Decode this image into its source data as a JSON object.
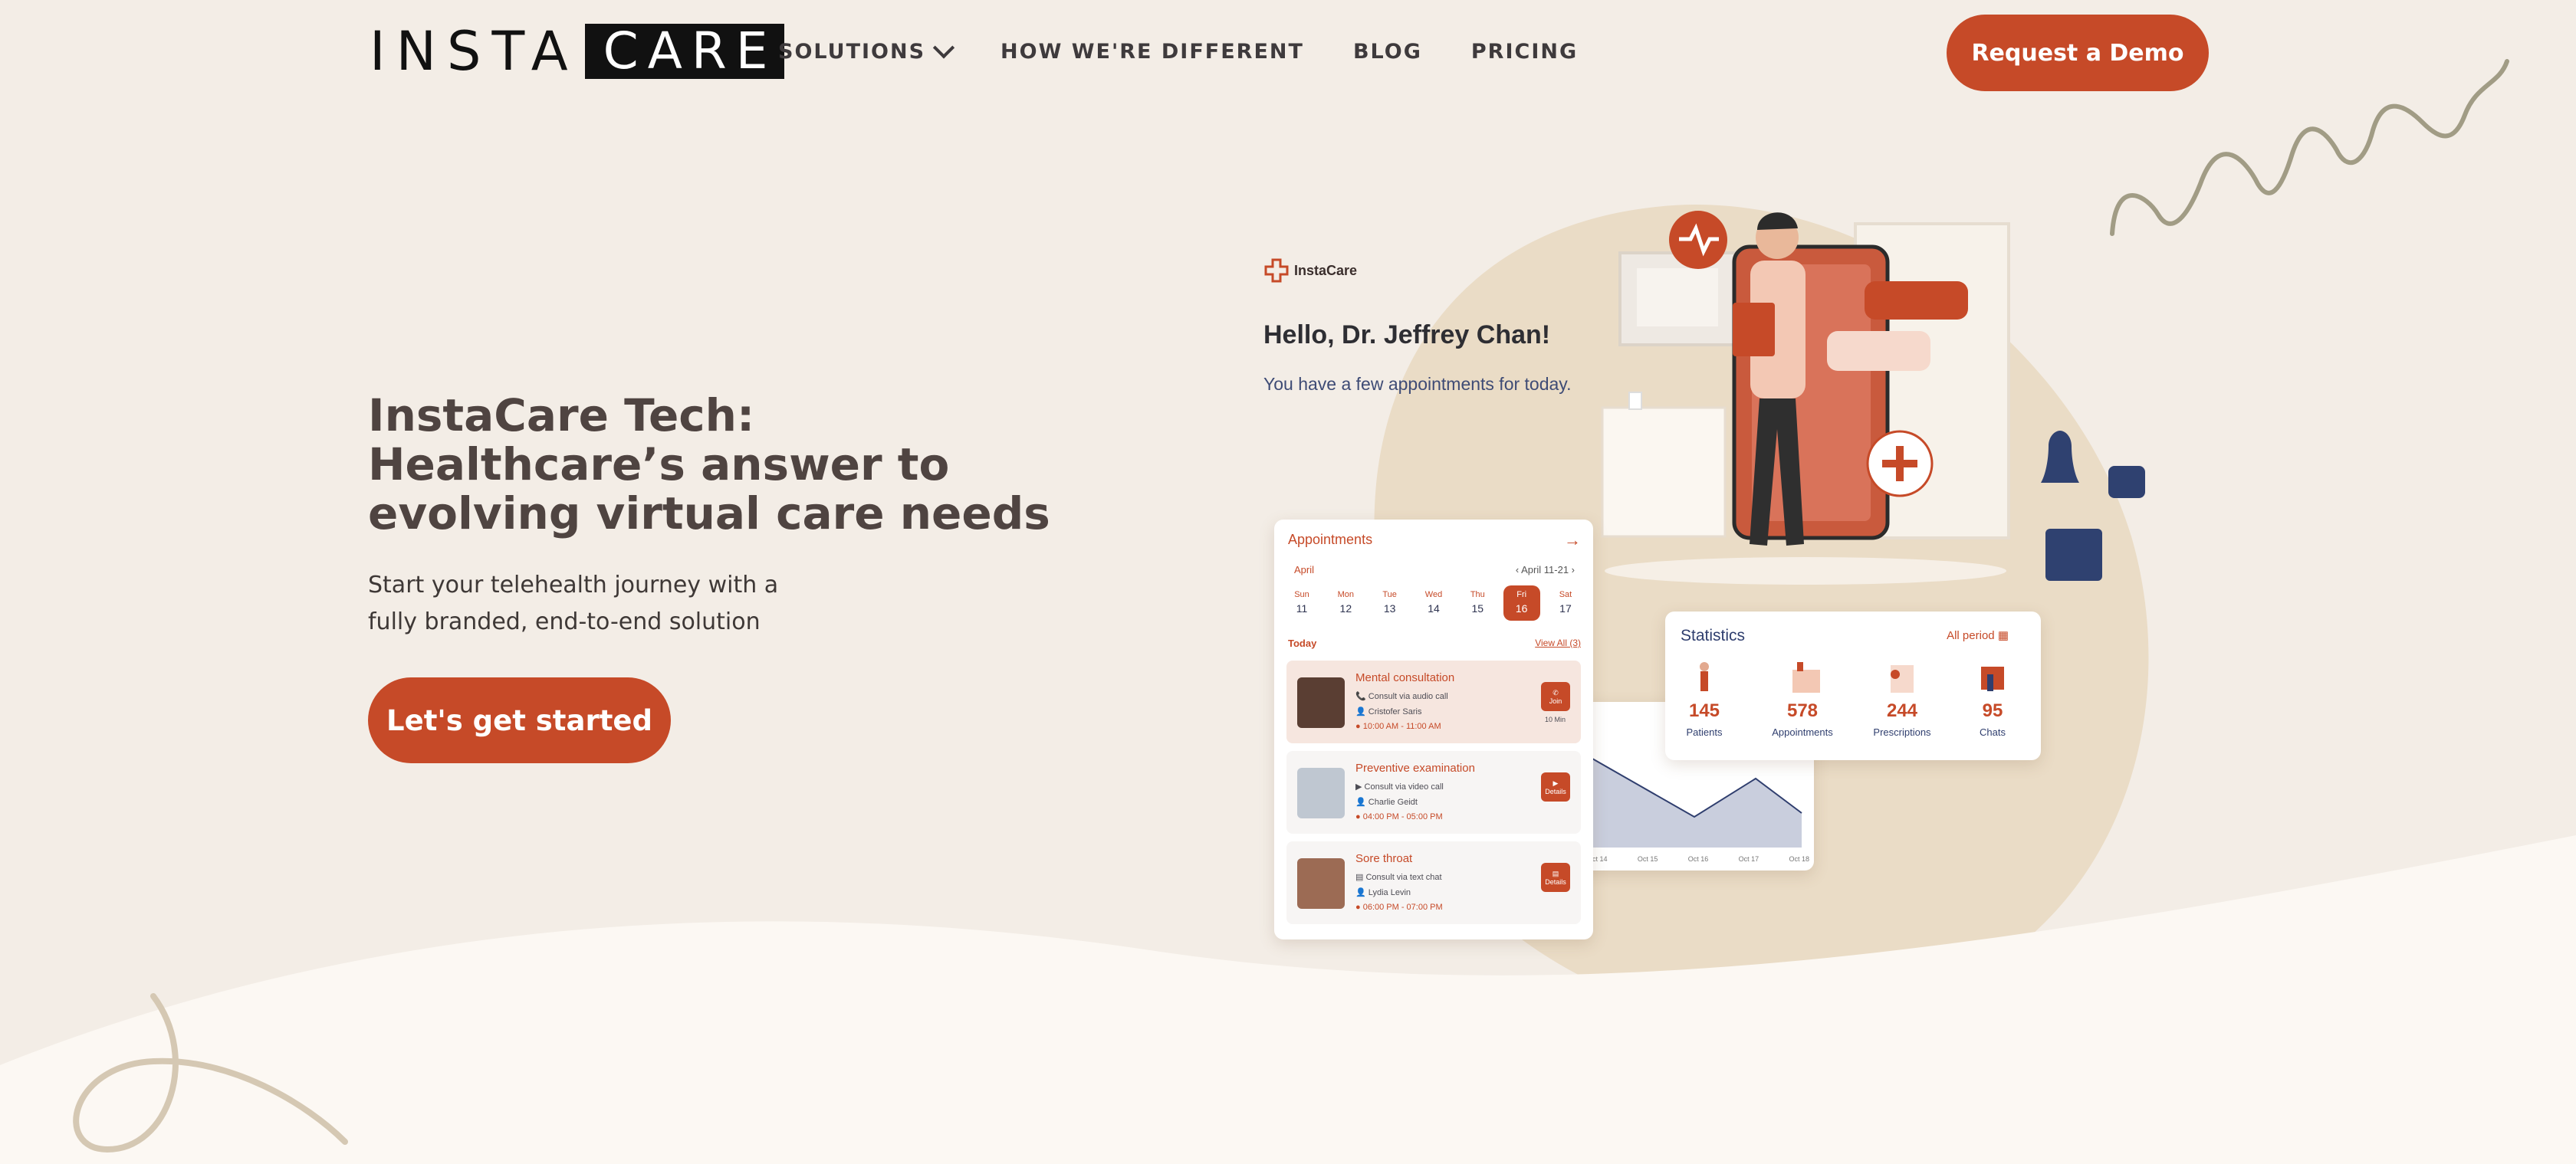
{
  "header": {
    "logo": {
      "part1": "INSTA",
      "part2": "CARE"
    },
    "nav": [
      {
        "label": "SOLUTIONS",
        "has_dropdown": true
      },
      {
        "label": "HOW WE'RE DIFFERENT"
      },
      {
        "label": "BLOG"
      },
      {
        "label": "PRICING"
      }
    ],
    "demo_button": "Request a Demo"
  },
  "hero": {
    "title_lines": [
      "InstaCare Tech:",
      "Healthcare’s answer to",
      "evolving virtual care needs"
    ],
    "subtitle_lines": [
      "Start your telehealth journey with a",
      "fully branded, end-to-end solution"
    ],
    "cta": "Let's get started"
  },
  "illustration": {
    "app_brand": "InstaCare",
    "greeting": "Hello, Dr. Jeffrey Chan!",
    "greeting_sub": "You have a few appointments for today.",
    "appointments": {
      "title": "Appointments",
      "month": "April",
      "range": "April 11-21",
      "days": [
        {
          "d": "Sun",
          "n": "11"
        },
        {
          "d": "Mon",
          "n": "12"
        },
        {
          "d": "Tue",
          "n": "13"
        },
        {
          "d": "Wed",
          "n": "14"
        },
        {
          "d": "Thu",
          "n": "15"
        },
        {
          "d": "Fri",
          "n": "16",
          "selected": true
        },
        {
          "d": "Sat",
          "n": "17"
        }
      ],
      "today_label": "Today",
      "view_all": "View All (3)",
      "items": [
        {
          "title": "Mental consultation",
          "mode": "Consult via audio call",
          "patient": "Cristofer Saris",
          "time": "10:00 AM - 11:00 AM",
          "action": "Join",
          "note": "10 Min"
        },
        {
          "title": "Preventive examination",
          "mode": "Consult via video call",
          "patient": "Charlie Geidt",
          "time": "04:00 PM - 05:00 PM",
          "action": "Details"
        },
        {
          "title": "Sore throat",
          "mode": "Consult via text chat",
          "patient": "Lydia Levin",
          "time": "06:00 PM - 07:00 PM",
          "action": "Details"
        }
      ]
    },
    "statistics": {
      "title": "Statistics",
      "period": "All period",
      "items": [
        {
          "value": "145",
          "label": "Patients"
        },
        {
          "value": "578",
          "label": "Appointments"
        },
        {
          "value": "244",
          "label": "Prescriptions"
        },
        {
          "value": "95",
          "label": "Chats"
        }
      ]
    },
    "chart_ticks": [
      "Oct 14",
      "Oct 15",
      "Oct 16",
      "Oct 17",
      "Oct 18"
    ]
  },
  "colors": {
    "accent": "#c64a28",
    "background": "#f3ede6",
    "cream": "#fcf8f3",
    "blob": "#eadcc6",
    "navy": "#2f3e6e"
  }
}
